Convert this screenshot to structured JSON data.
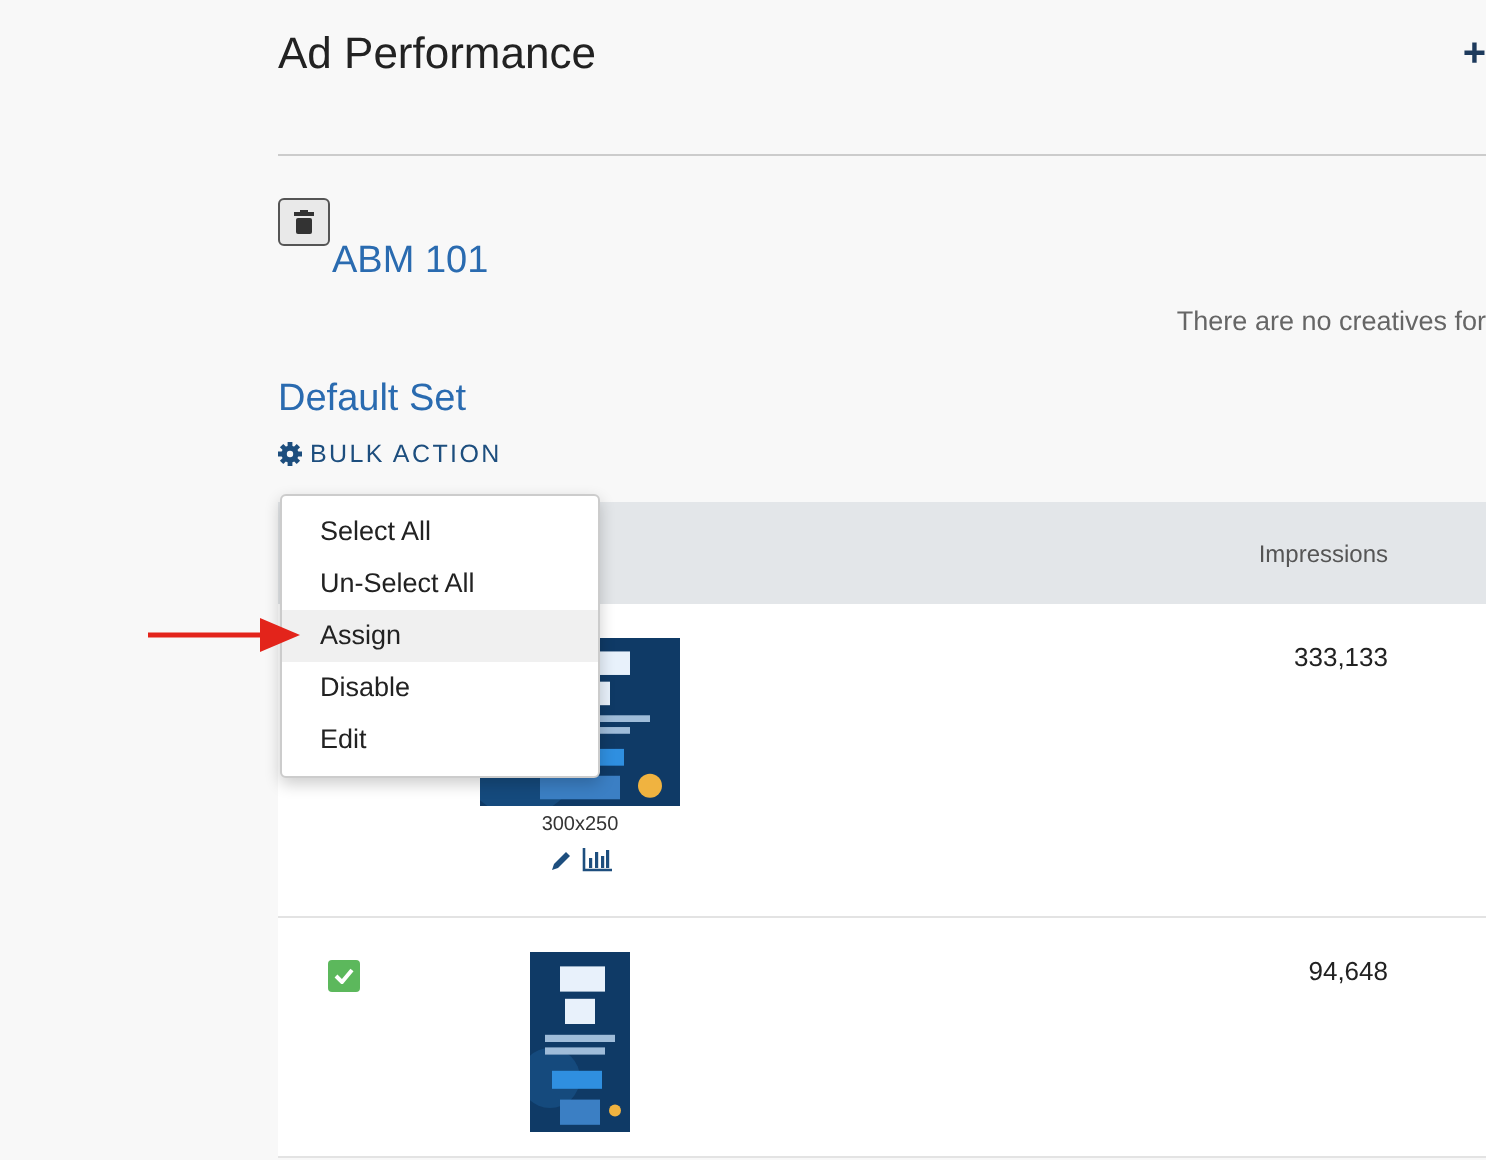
{
  "page": {
    "title": "Ad Performance",
    "add_icon": "+"
  },
  "campaign": {
    "name": "ABM 101",
    "empty_message": "There are no creatives for"
  },
  "set": {
    "name": "Default Set",
    "bulk_action": "BULK ACTION"
  },
  "menu": [
    {
      "label": "Select All",
      "selected": false
    },
    {
      "label": "Un-Select All",
      "selected": false
    },
    {
      "label": "Assign",
      "selected": true
    },
    {
      "label": "Disable",
      "selected": false
    },
    {
      "label": "Edit",
      "selected": false
    }
  ],
  "table": {
    "columns": [
      "Impressions"
    ],
    "rows": [
      {
        "creative": {
          "kind": "picture",
          "size": "300x250"
        },
        "impressions": "333,133"
      },
      {
        "checked": true,
        "impressions": "94,648"
      }
    ]
  }
}
